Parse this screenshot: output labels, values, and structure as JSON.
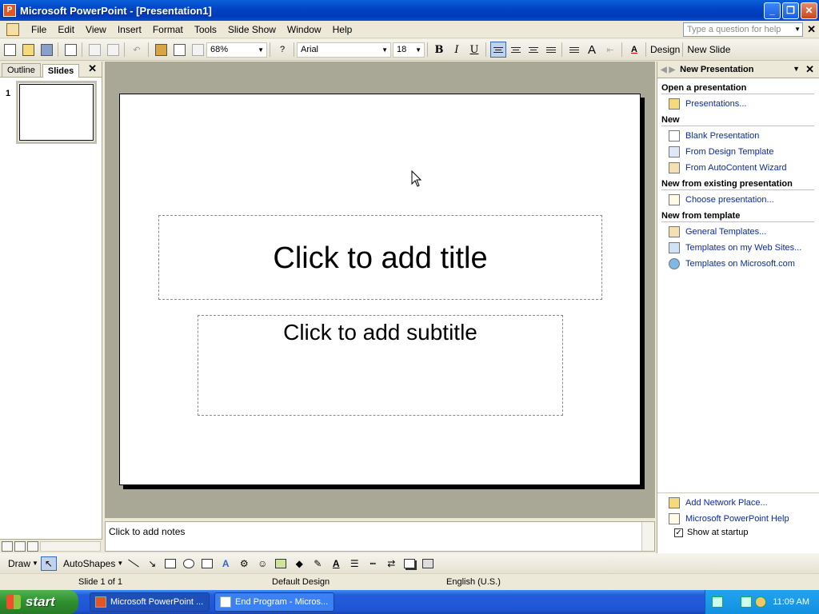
{
  "window": {
    "title": "Microsoft PowerPoint - [Presentation1]",
    "app_icon": "P"
  },
  "menu": {
    "items": [
      "File",
      "Edit",
      "View",
      "Insert",
      "Format",
      "Tools",
      "Slide Show",
      "Window",
      "Help"
    ],
    "help_placeholder": "Type a question for help"
  },
  "toolbar": {
    "zoom": "68%",
    "font": "Arial",
    "font_size": "18",
    "bold": "B",
    "italic": "I",
    "underline": "U",
    "design_label": "Design",
    "new_slide_label": "New Slide"
  },
  "left_pane": {
    "tabs": [
      "Outline",
      "Slides"
    ],
    "active_tab": "Slides",
    "slide_number": "1"
  },
  "slide": {
    "title_placeholder": "Click to add title",
    "subtitle_placeholder": "Click to add subtitle"
  },
  "notes": {
    "placeholder": "Click to add notes"
  },
  "task_pane": {
    "title": "New Presentation",
    "sections": [
      {
        "heading": "Open a presentation",
        "links": [
          "Presentations..."
        ]
      },
      {
        "heading": "New",
        "links": [
          "Blank Presentation",
          "From Design Template",
          "From AutoContent Wizard"
        ]
      },
      {
        "heading": "New from existing presentation",
        "links": [
          "Choose presentation..."
        ]
      },
      {
        "heading": "New from template",
        "links": [
          "General Templates...",
          "Templates on my Web Sites...",
          "Templates on Microsoft.com"
        ]
      }
    ],
    "bottom_links": [
      "Add Network Place...",
      "Microsoft PowerPoint Help"
    ],
    "show_at_startup": "Show at startup"
  },
  "draw_toolbar": {
    "draw_label": "Draw",
    "autoshapes_label": "AutoShapes"
  },
  "status": {
    "slide": "Slide 1 of 1",
    "design": "Default Design",
    "language": "English (U.S.)"
  },
  "taskbar": {
    "start_label": "start",
    "tasks": [
      "Microsoft PowerPoint ...",
      "End Program - Micros..."
    ],
    "clock": "11:09 AM"
  }
}
